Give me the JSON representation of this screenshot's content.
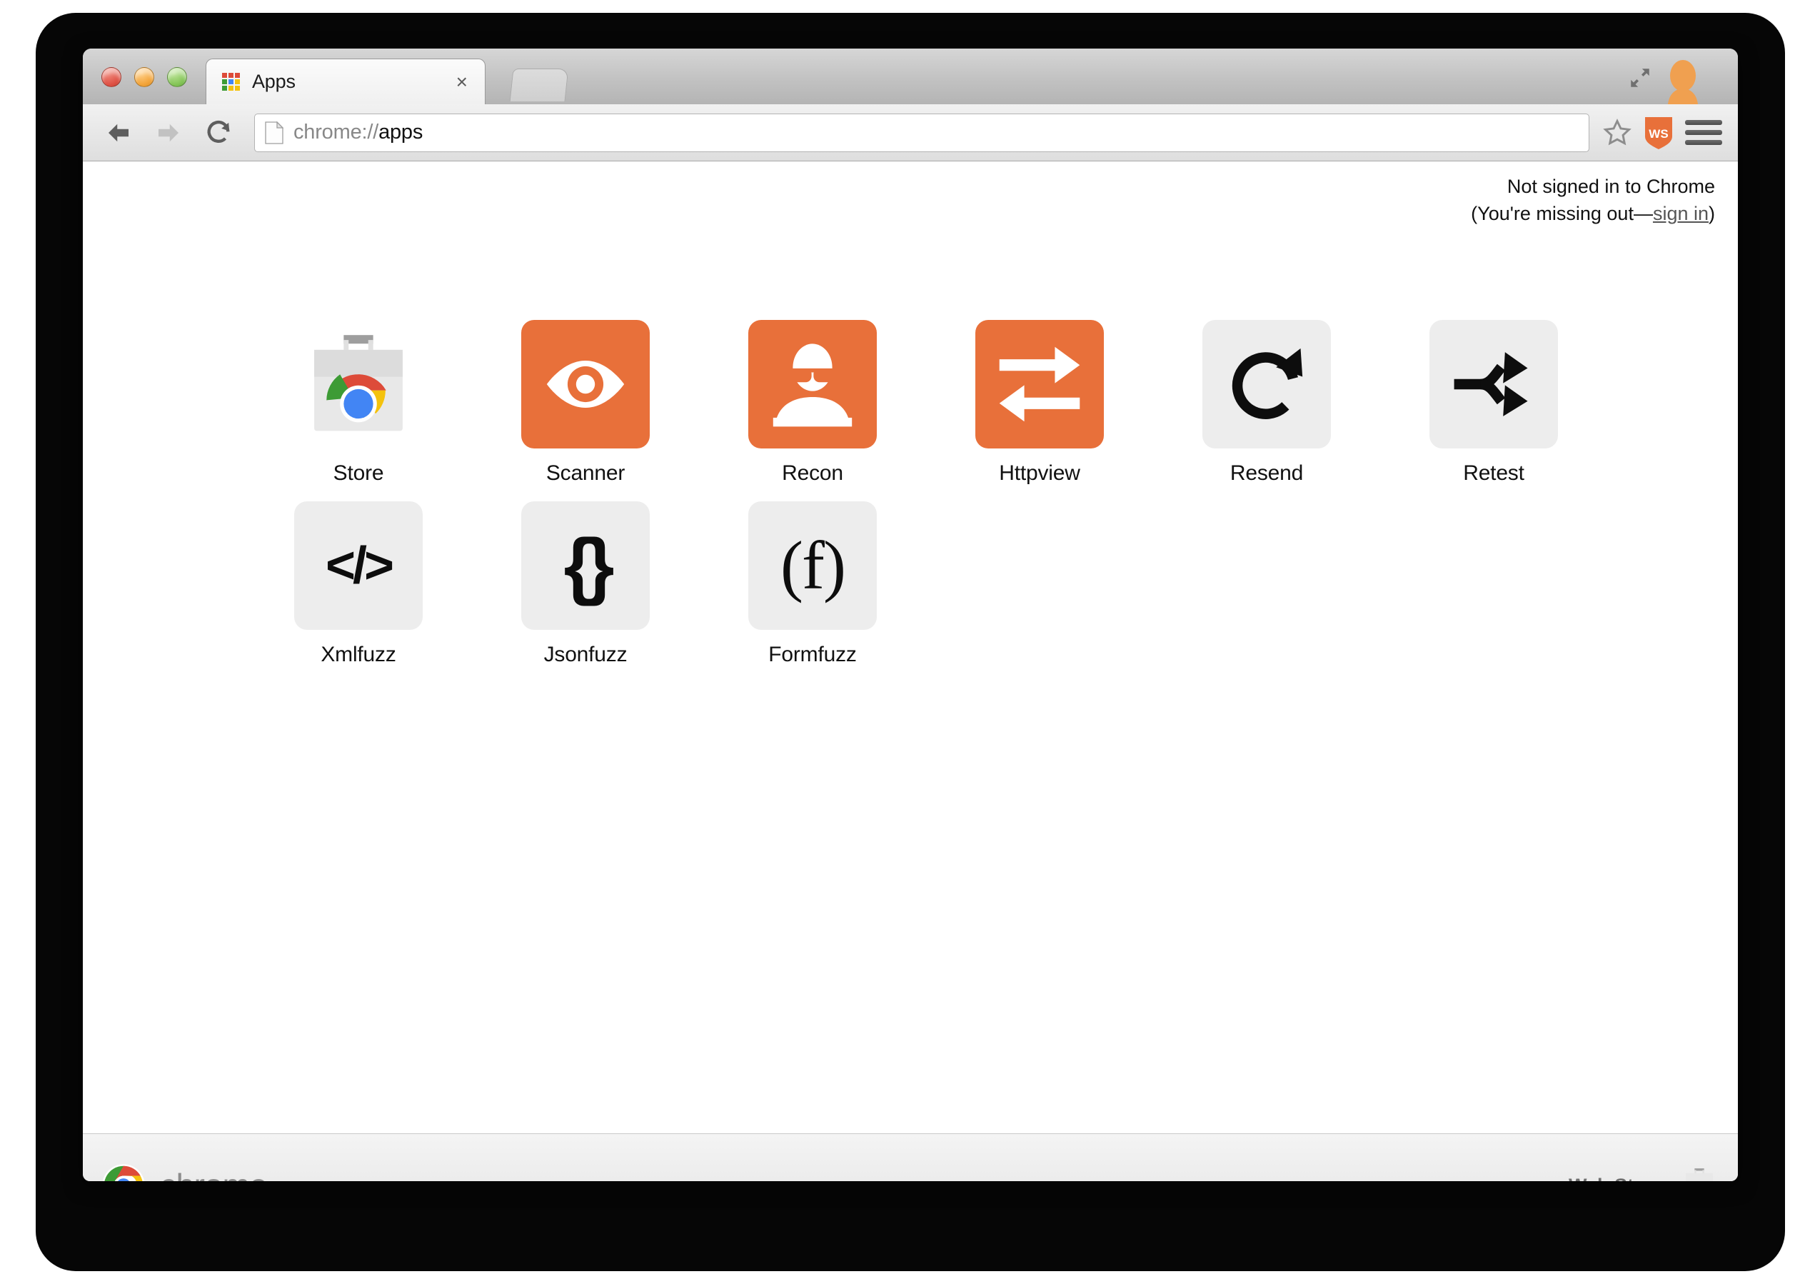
{
  "window": {
    "traffic_lights": [
      "close",
      "minimize",
      "zoom"
    ],
    "expand_icon": "fullscreen-expand-icon",
    "avatar_icon": "user-avatar-icon"
  },
  "tab": {
    "title": "Apps",
    "favicon": "apps-grid-favicon",
    "close_label": "×",
    "new_tab_label": ""
  },
  "toolbar": {
    "back_icon": "back-arrow-icon",
    "forward_icon": "forward-arrow-icon",
    "reload_icon": "reload-icon",
    "page_icon": "page-document-icon",
    "url_scheme": "chrome://",
    "url_path": "apps",
    "url_full": "chrome://apps",
    "star_icon": "bookmark-star-icon",
    "ws_badge_label": "WS",
    "menu_icon": "hamburger-menu-icon"
  },
  "signin": {
    "line1": "Not signed in to Chrome",
    "prefix": "(You're missing out—",
    "link": "sign in",
    "suffix": ")"
  },
  "apps": [
    {
      "label": "Store",
      "icon": "chrome-web-store-bag-icon",
      "tile": "plain",
      "glyph": ""
    },
    {
      "label": "Scanner",
      "icon": "eye-icon",
      "tile": "orange",
      "glyph": ""
    },
    {
      "label": "Recon",
      "icon": "spy-person-sunglasses-icon",
      "tile": "orange",
      "glyph": ""
    },
    {
      "label": "Httpview",
      "icon": "two-way-arrows-icon",
      "tile": "orange",
      "glyph": ""
    },
    {
      "label": "Resend",
      "icon": "refresh-circular-arrow-icon",
      "tile": "gray",
      "glyph": ""
    },
    {
      "label": "Retest",
      "icon": "split-fork-arrow-icon",
      "tile": "gray",
      "glyph": ""
    },
    {
      "label": "Xmlfuzz",
      "icon": "code-tags-icon",
      "tile": "gray",
      "glyph": "</>"
    },
    {
      "label": "Jsonfuzz",
      "icon": "curly-braces-icon",
      "tile": "gray",
      "glyph": "{}"
    },
    {
      "label": "Formfuzz",
      "icon": "function-parens-icon",
      "tile": "gray",
      "glyph": "(f)"
    }
  ],
  "footer": {
    "brand": "chrome",
    "brand_icon": "chrome-logo-icon",
    "webstore_label": "Web Store",
    "webstore_icon": "web-store-bag-icon"
  },
  "colors": {
    "accent_orange": "#e8703a",
    "tile_gray": "#ededed",
    "link_gray": "#555555"
  }
}
